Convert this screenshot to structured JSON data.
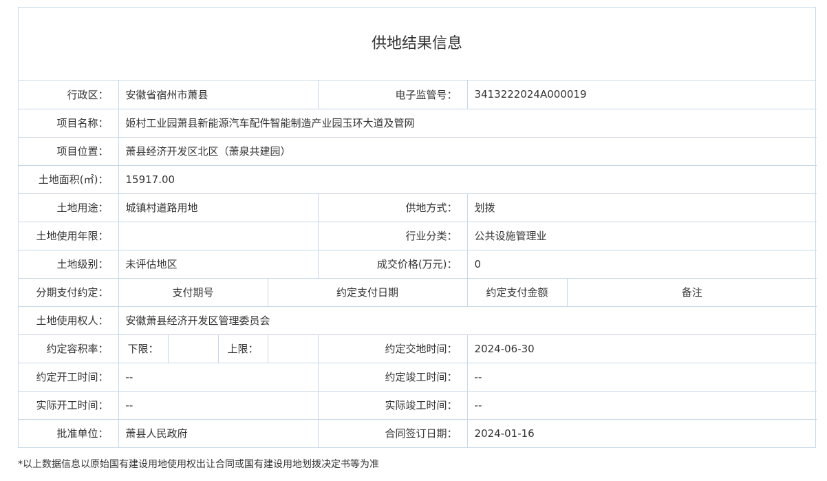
{
  "title": "供地结果信息",
  "fields": {
    "district": {
      "label": "行政区：",
      "value": "安徽省宿州市萧县"
    },
    "supervision_no": {
      "label": "电子监管号：",
      "value": "3413222024A000019"
    },
    "project_name": {
      "label": "项目名称：",
      "value": "姬村工业园萧县新能源汽车配件智能制造产业园玉环大道及管网"
    },
    "project_location": {
      "label": "项目位置：",
      "value": "萧县经济开发区北区（萧泉共建园）"
    },
    "land_area": {
      "label": "土地面积(㎡)：",
      "value": "15917.00"
    },
    "land_use": {
      "label": "土地用途：",
      "value": "城镇村道路用地"
    },
    "supply_method": {
      "label": "供地方式：",
      "value": "划拨"
    },
    "use_term": {
      "label": "土地使用年限：",
      "value": ""
    },
    "industry": {
      "label": "行业分类：",
      "value": "公共设施管理业"
    },
    "land_grade": {
      "label": "土地级别：",
      "value": "未评估地区"
    },
    "price": {
      "label": "成交价格(万元)：",
      "value": "0"
    },
    "installment": {
      "label": "分期支付约定：",
      "headers": [
        "支付期号",
        "约定支付日期",
        "约定支付金额",
        "备注"
      ]
    },
    "right_holder": {
      "label": "土地使用权人：",
      "value": "安徽萧县经济开发区管理委员会"
    },
    "plot_ratio": {
      "label": "约定容积率：",
      "lower_label": "下限：",
      "lower_value": "",
      "upper_label": "上限：",
      "upper_value": ""
    },
    "delivery_time": {
      "label": "约定交地时间：",
      "value": "2024-06-30"
    },
    "agreed_start": {
      "label": "约定开工时间：",
      "value": "--"
    },
    "agreed_finish": {
      "label": "约定竣工时间：",
      "value": "--"
    },
    "actual_start": {
      "label": "实际开工时间：",
      "value": "--"
    },
    "actual_finish": {
      "label": "实际竣工时间：",
      "value": "--"
    },
    "approver": {
      "label": "批准单位：",
      "value": "萧县人民政府"
    },
    "contract_date": {
      "label": "合同签订日期：",
      "value": "2024-01-16"
    }
  },
  "footnote": "*以上数据信息以原始国有建设用地使用权出让合同或国有建设用地划拨决定书等为准"
}
